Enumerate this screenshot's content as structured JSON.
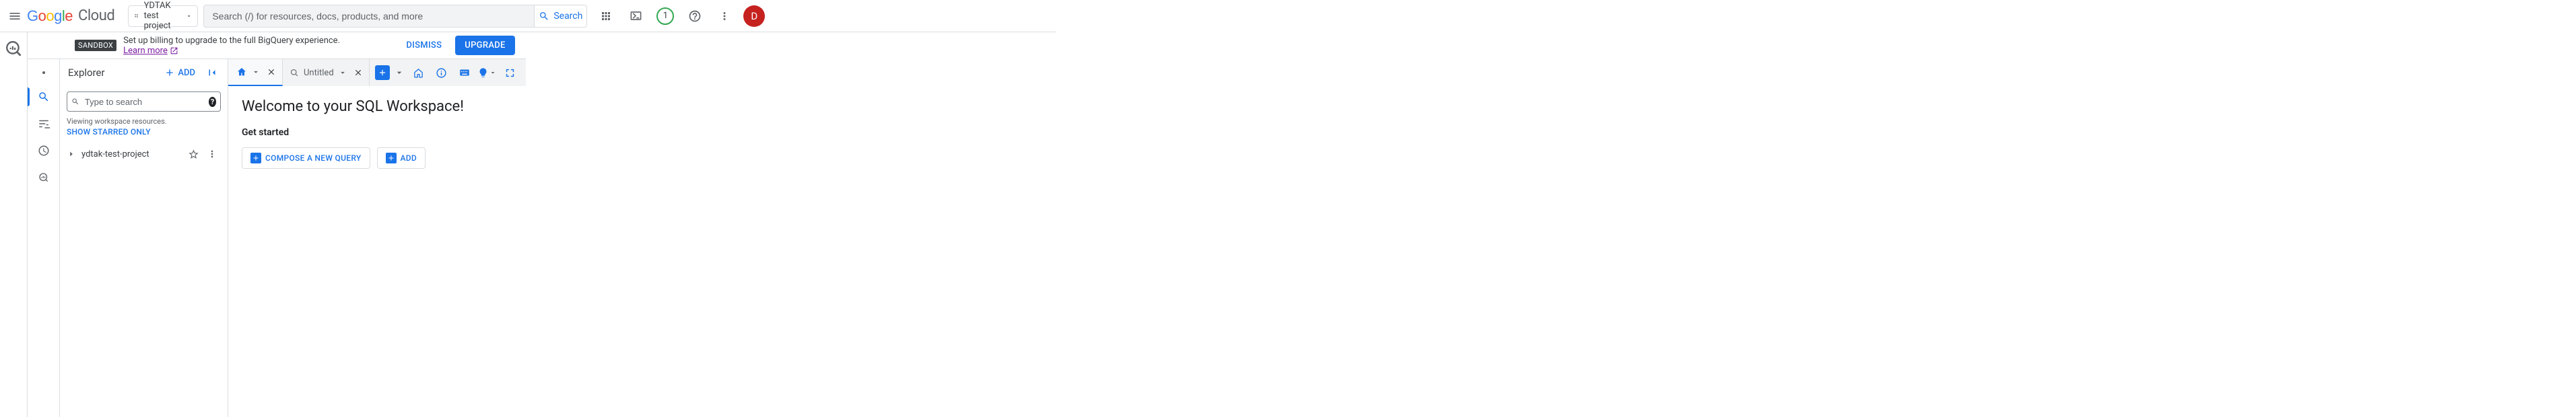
{
  "header": {
    "cloud_label": "Cloud",
    "project_name": "YDTAK test project",
    "search_placeholder": "Search (/) for resources, docs, products, and more",
    "search_button": "Search",
    "badge_count": "1",
    "avatar_letter": "D"
  },
  "banner": {
    "chip": "SANDBOX",
    "text": "Set up billing to upgrade to the full BigQuery experience.",
    "link": "Learn more",
    "dismiss": "DISMISS",
    "upgrade": "UPGRADE"
  },
  "explorer": {
    "title": "Explorer",
    "add": "ADD",
    "search_placeholder": "Type to search",
    "viewing": "Viewing workspace resources.",
    "starred": "SHOW STARRED ONLY",
    "project": "ydtak-test-project"
  },
  "tabs": {
    "untitled": "Untitled"
  },
  "workspace": {
    "title": "Welcome to your SQL Workspace!",
    "subtitle": "Get started",
    "compose": "COMPOSE A NEW QUERY",
    "add": "ADD"
  }
}
